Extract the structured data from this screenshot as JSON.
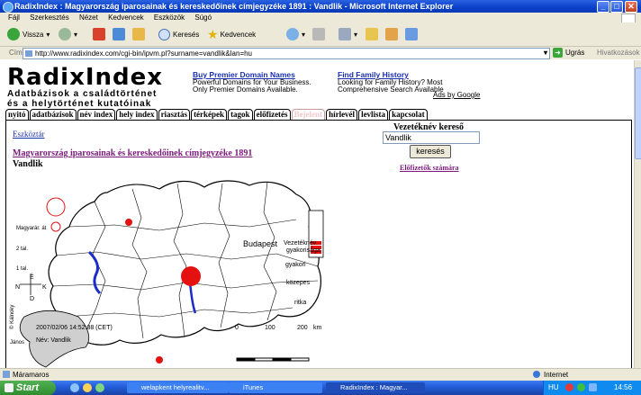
{
  "window": {
    "title": "RadixIndex : Magyarország iparosainak és kereskedőinek címjegyzéke 1891 : Vandlik - Microsoft Internet Explorer"
  },
  "menu": [
    "Fájl",
    "Szerkesztés",
    "Nézet",
    "Kedvencek",
    "Eszközök",
    "Súgó"
  ],
  "toolbar": {
    "back": "Vissza",
    "search": "Keresés",
    "favorites": "Kedvencek"
  },
  "address": {
    "label": "Cím",
    "url": "http://www.radixindex.com/cgi-bin/ipvm.pl?surname=vandlik&lan=hu",
    "go": "Ugrás",
    "links": "Hivatkozások"
  },
  "site": {
    "logo": "RadixIndex",
    "tagline1": "Adatbázisok a családtörténet",
    "tagline2": "és a helytörténet kutatóinak",
    "ad1": {
      "title": "Buy Premier Domain Names",
      "line1": "Powerful Domains for Your Business.",
      "line2": "Only Premier Domains Available."
    },
    "ad2": {
      "title": "Find Family History",
      "line1": "Looking for Family History? Most",
      "line2": "Comprehensive Search Available"
    },
    "ads_by": "Ads by Google"
  },
  "tabs": [
    "nyitó",
    "adatbázisok",
    "név index",
    "hely index",
    "riasztás",
    "térképek",
    "tagok",
    "előfizetés",
    "Bejelent",
    "hírlevél",
    "levlista",
    "kapcsolat"
  ],
  "content": {
    "breadcrumb": "Eszköztár",
    "db_title": "Magyarország iparosainak és kereskedőinek címjegyzéke 1891",
    "surname": "Vandlik",
    "search_heading": "Vezetéknév kereső",
    "search_value": "Vandlik",
    "search_button": "keresés",
    "subscriber_link": "Előfizetők számára"
  },
  "map": {
    "legend_title": "Magyarár. át",
    "legend_2": "2 tal.",
    "legend_1": "1 tal.",
    "city": "Budapest",
    "freq_title1": "Vezetéknév",
    "freq_title2": "gyakorisága",
    "freq_high": "gyakori",
    "freq_mid": "közepes",
    "freq_low": "ritka",
    "frequency_level": "ritka",
    "compass_n": "É",
    "compass_s": "D",
    "compass_w": "N",
    "compass_e": "K",
    "timestamp": "2007/02/06 14:52:38 (CET)",
    "name_label": "Név: Vandlik",
    "scale_0": "0",
    "scale_100": "100",
    "scale_200": "200",
    "scale_unit": "km",
    "author1": "© Kálnoky",
    "author2": "János"
  },
  "status": {
    "left": "Máramaros",
    "zone": "Internet"
  },
  "taskbar": {
    "start": "Start",
    "tasks": [
      "welapkent helyrealitv...",
      "iTunes",
      "RadixIndex : Magyar..."
    ],
    "lang": "HU",
    "time": "14:56"
  }
}
